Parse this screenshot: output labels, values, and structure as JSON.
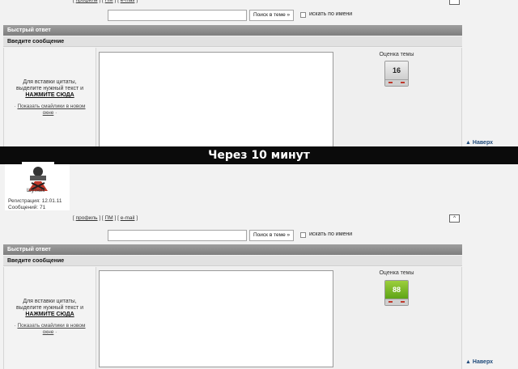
{
  "top": {
    "links": [
      "профиль",
      "ПМ",
      "e-mail"
    ],
    "up_symbol": "^"
  },
  "search": {
    "button": "Поиск в теме »",
    "checkbox_label": "искать по имени",
    "value": ""
  },
  "quick_reply": {
    "header": "Быстрый ответ",
    "subheader": "Введите сообщение",
    "hint_line1": "Для вставки цитаты,",
    "hint_line2": "выделите нужный текст и",
    "hint_cta": "НАЖМИТЕ СЮДА",
    "smiles_prefix": "·",
    "smiles_link1": "Показать смайлики в новом",
    "smiles_link2": "окне",
    "smiles_suffix": "·",
    "rating_label": "Оценка темы"
  },
  "ratings": {
    "before": "16",
    "after": "88"
  },
  "nav": {
    "back_to_top": "Наверх",
    "arrow": "▲"
  },
  "divider": {
    "text": "Через 10 минут"
  },
  "user": {
    "name": "Шутник",
    "reg_label": "Регистрация: 12.01.11",
    "posts_label": "Сообщений: 71"
  },
  "colors": {
    "accent_link": "#1f4a7a",
    "rating_green": "#7bbd2a"
  }
}
